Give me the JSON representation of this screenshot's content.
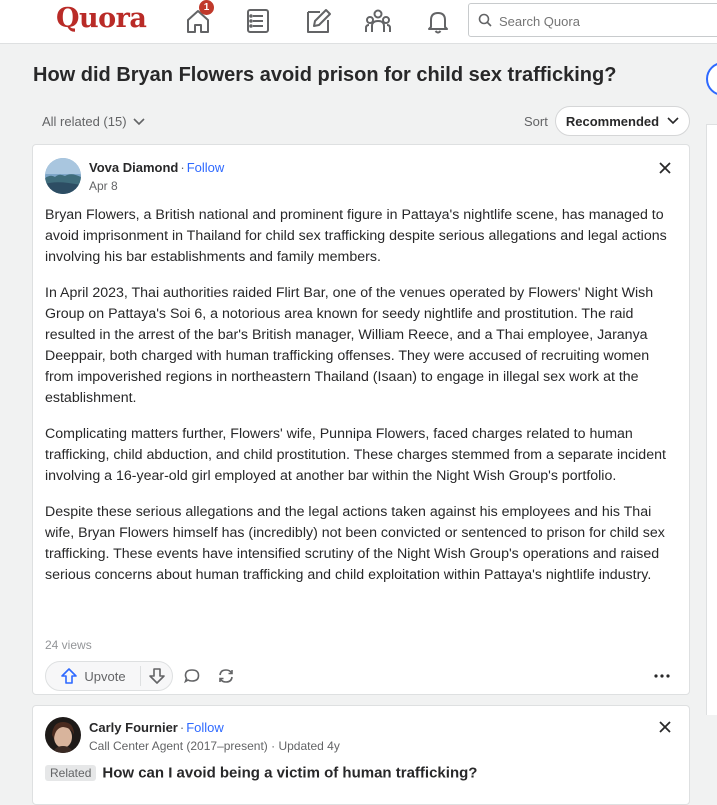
{
  "nav": {
    "logo": "Quora",
    "notification_count": "1",
    "icons": [
      "home-icon",
      "following-icon",
      "answer-icon",
      "spaces-icon",
      "notifications-icon"
    ],
    "search_placeholder": "Search Quora"
  },
  "question": {
    "title": "How did Bryan Flowers avoid prison for child sex trafficking?",
    "filter_label": "All related (15)",
    "sort_label": "Sort",
    "sort_value": "Recommended"
  },
  "answers": [
    {
      "author": "Vova Diamond",
      "follow": "Follow",
      "date": "Apr 8",
      "paragraphs": [
        "Bryan Flowers, a British national and prominent figure in Pattaya's nightlife scene, has managed to avoid imprisonment in Thailand for child sex trafficking despite serious allegations and legal actions involving his bar establishments and family members.",
        "In April 2023, Thai authorities raided Flirt Bar, one of the venues operated by Flowers' Night Wish Group on Pattaya's Soi 6, a notorious area known for seedy nightlife and prostitution. The raid resulted in the arrest of the bar's British manager, William Reece, and a Thai employee, Jaranya Deeppair, both charged with human trafficking offenses. They were accused of recruiting women from impoverished regions in northeastern Thailand (Isaan) to engage in illegal sex work at the establishment.",
        "Complicating matters further, Flowers' wife, Punnipa Flowers, faced charges related to human trafficking, child abduction, and child prostitution. These charges stemmed from a separate incident involving a 16-year-old girl employed at another bar within the Night Wish Group's portfolio.",
        "Despite these serious allegations and the legal actions taken against his employees and his Thai wife, Bryan Flowers himself has (incredibly) not been convicted or sentenced to prison for child sex trafficking. These events have intensified scrutiny of the Night Wish Group's operations and raised serious concerns about human trafficking and child exploitation within Pattaya's nightlife industry."
      ],
      "views": "24 views",
      "upvote_label": "Upvote"
    },
    {
      "author": "Carly Fournier",
      "follow": "Follow",
      "credential": "Call Center Agent (2017–present) · Updated 4y",
      "related_tag": "Related",
      "related_question": "How can I avoid being a victim of human trafficking?"
    }
  ],
  "colors": {
    "brand": "#b92b27",
    "link": "#2e69ff",
    "badge": "#c0392b"
  }
}
